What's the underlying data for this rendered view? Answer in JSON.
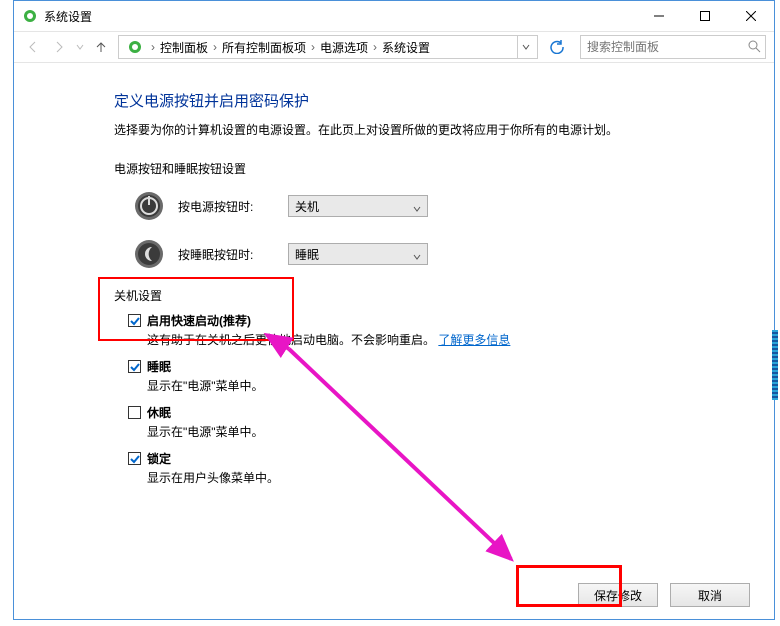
{
  "titlebar": {
    "title": "系统设置"
  },
  "nav": {
    "breadcrumb": [
      "控制面板",
      "所有控制面板项",
      "电源选项",
      "系统设置"
    ],
    "search_placeholder": "搜索控制面板"
  },
  "page": {
    "title": "定义电源按钮并启用密码保护",
    "desc": "选择要为你的计算机设置的电源设置。在此页上对设置所做的更改将应用于你所有的电源计划。",
    "section_power_sleep": "电源按钮和睡眠按钮设置",
    "power_button_label": "按电源按钮时:",
    "power_button_value": "关机",
    "sleep_button_label": "按睡眠按钮时:",
    "sleep_button_value": "睡眠",
    "section_shutdown": "关机设置",
    "opts": {
      "fast_startup": {
        "label": "启用快速启动(推荐)",
        "sub": "这有助于在关机之后更快地启动电脑。不会影响重启。",
        "link": "了解更多信息",
        "checked": true
      },
      "sleep": {
        "label": "睡眠",
        "sub": "显示在\"电源\"菜单中。",
        "checked": true
      },
      "hibernate": {
        "label": "休眠",
        "sub": "显示在\"电源\"菜单中。",
        "checked": false
      },
      "lock": {
        "label": "锁定",
        "sub": "显示在用户头像菜单中。",
        "checked": true
      }
    }
  },
  "footer": {
    "save": "保存修改",
    "cancel": "取消"
  }
}
